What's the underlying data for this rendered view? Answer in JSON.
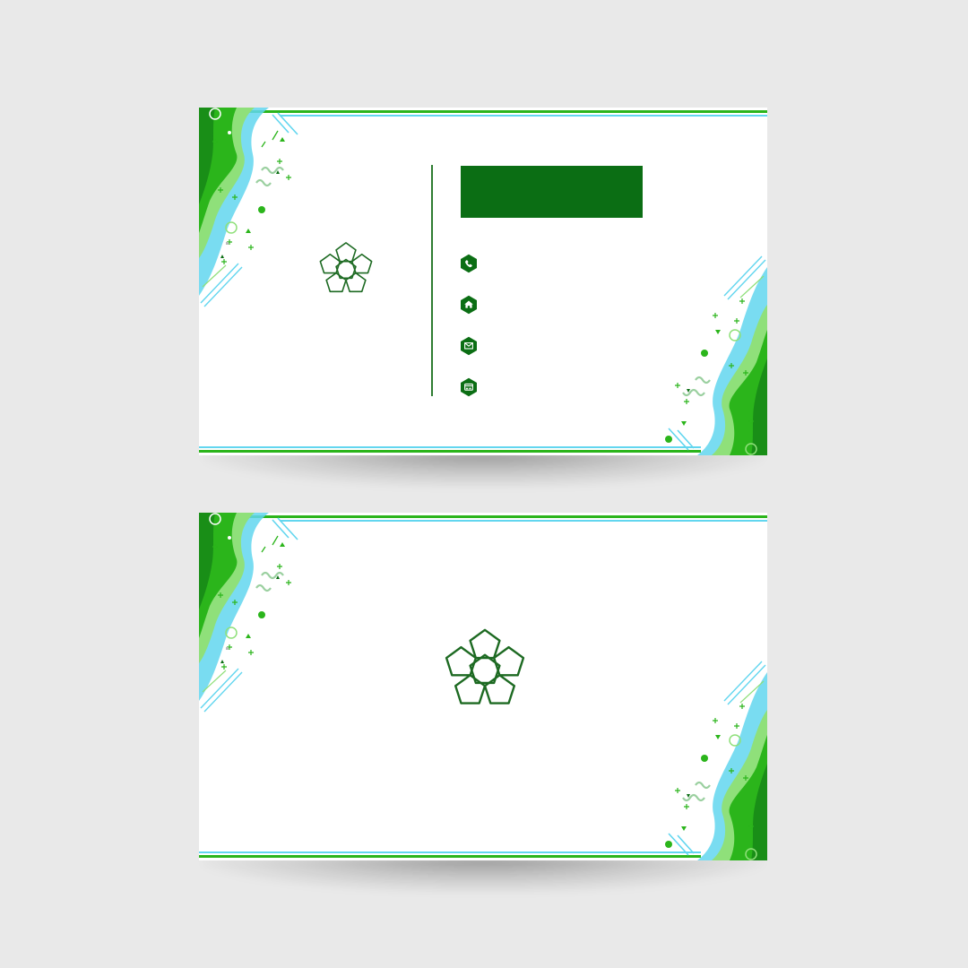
{
  "colors": {
    "background": "#e9e9e9",
    "card": "#ffffff",
    "brand_dark_green": "#0b6e14",
    "accent_green": "#2bb51b",
    "light_green": "#8fe07a",
    "accent_cyan": "#62d6ef",
    "logo_stroke": "#1d6a22"
  },
  "front": {
    "logo_icon": "pentagon-flower-icon",
    "name_block_color": "#0b6e14",
    "contacts": [
      {
        "icon": "phone-icon"
      },
      {
        "icon": "home-icon"
      },
      {
        "icon": "mail-icon"
      },
      {
        "icon": "web-icon"
      }
    ]
  },
  "back": {
    "logo_icon": "pentagon-flower-icon"
  }
}
